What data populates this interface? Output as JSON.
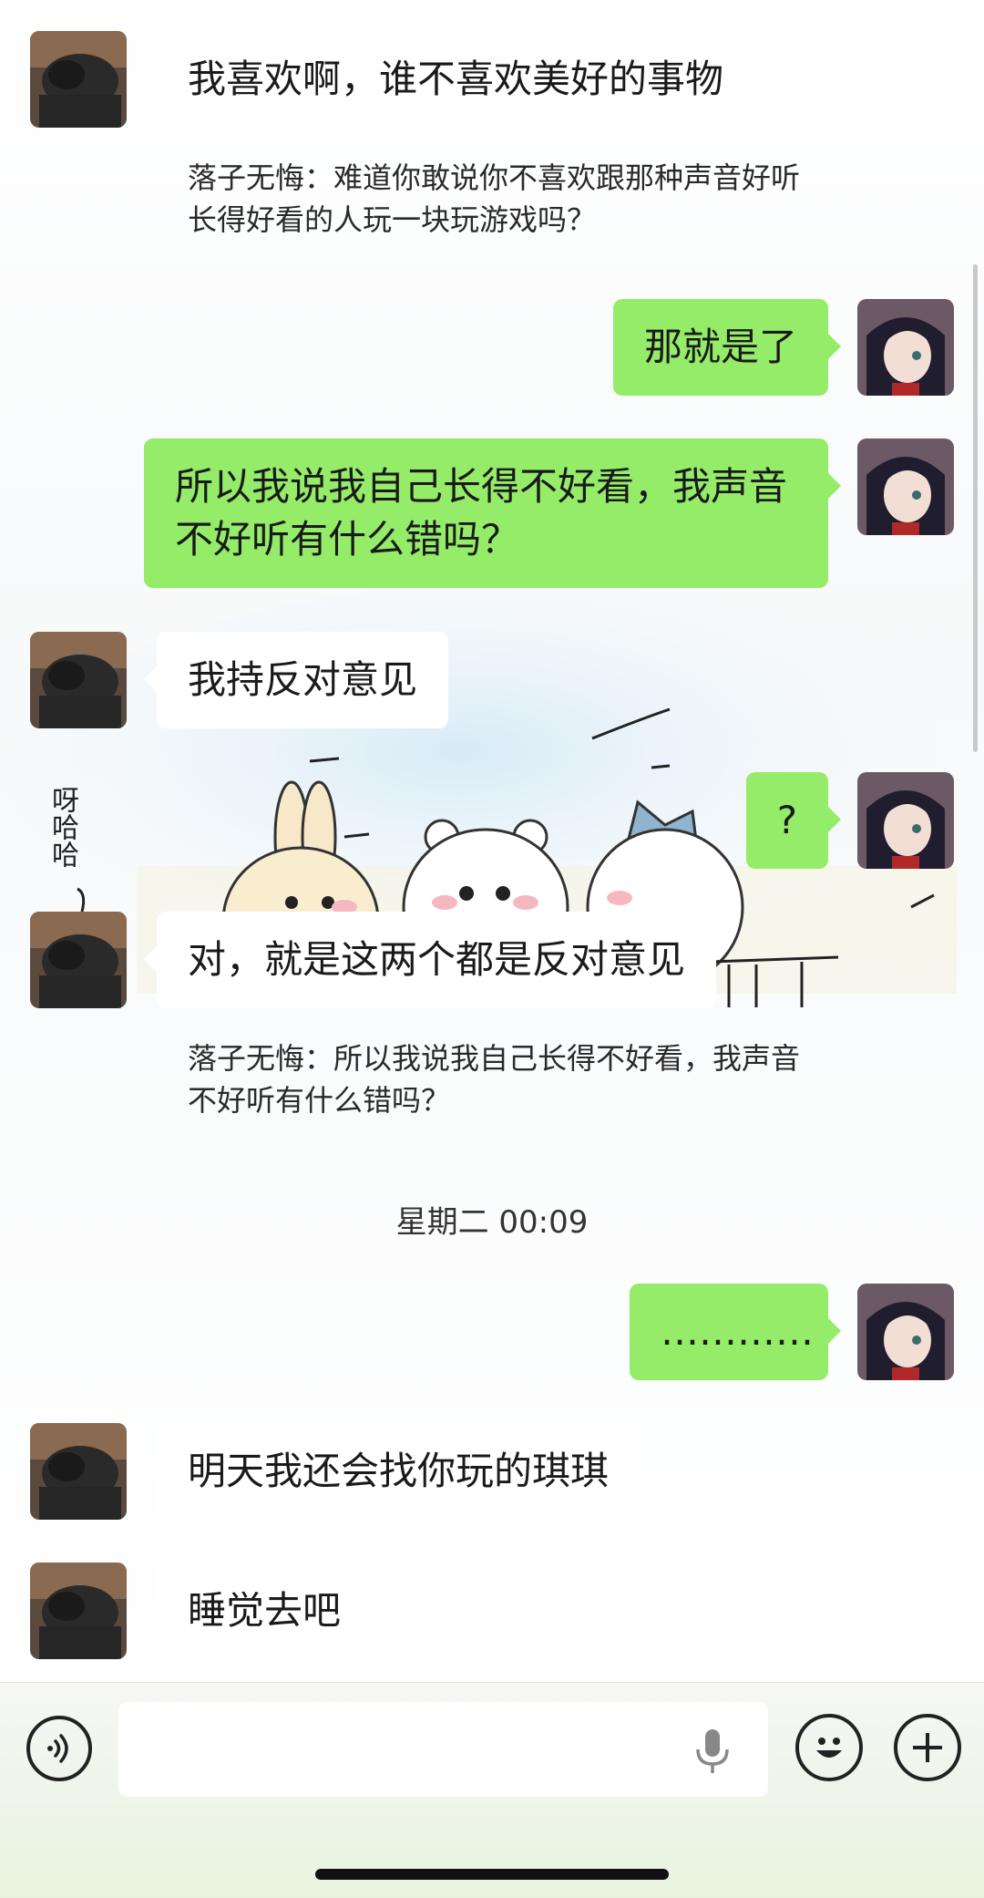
{
  "messages": {
    "m1": {
      "text": "我喜欢啊，谁不喜欢美好的事物",
      "quote": "落子无悔：难道你敢说你不喜欢跟那种声音好听 长得好看的人玩一块玩游戏吗？"
    },
    "m2": {
      "text": "那就是了"
    },
    "m3": {
      "text": "所以我说我自己长得不好看，我声音不好听有什么错吗？"
    },
    "m4": {
      "text": "我持反对意见"
    },
    "m5": {
      "text": "?"
    },
    "m6": {
      "text": "对，就是这两个都是反对意见",
      "quote": "落子无悔：所以我说我自己长得不好看，我声音不好听有什么错吗？"
    },
    "m7": {
      "text": "…………"
    },
    "m8": {
      "text": "明天我还会找你玩的琪琪"
    },
    "m9": {
      "text": "睡觉去吧"
    }
  },
  "timestamp": "星期二 00:09",
  "wallpaper": {
    "text": "呀哈哈"
  },
  "input": {
    "placeholder": ""
  },
  "icons": {
    "voice": "voice-icon",
    "mic": "microphone-icon",
    "emoji": "emoji-icon",
    "add": "plus-icon"
  },
  "colors": {
    "outgoing_bubble": "#95ec69",
    "incoming_bubble": "#ffffff",
    "background": "#ffffff"
  }
}
